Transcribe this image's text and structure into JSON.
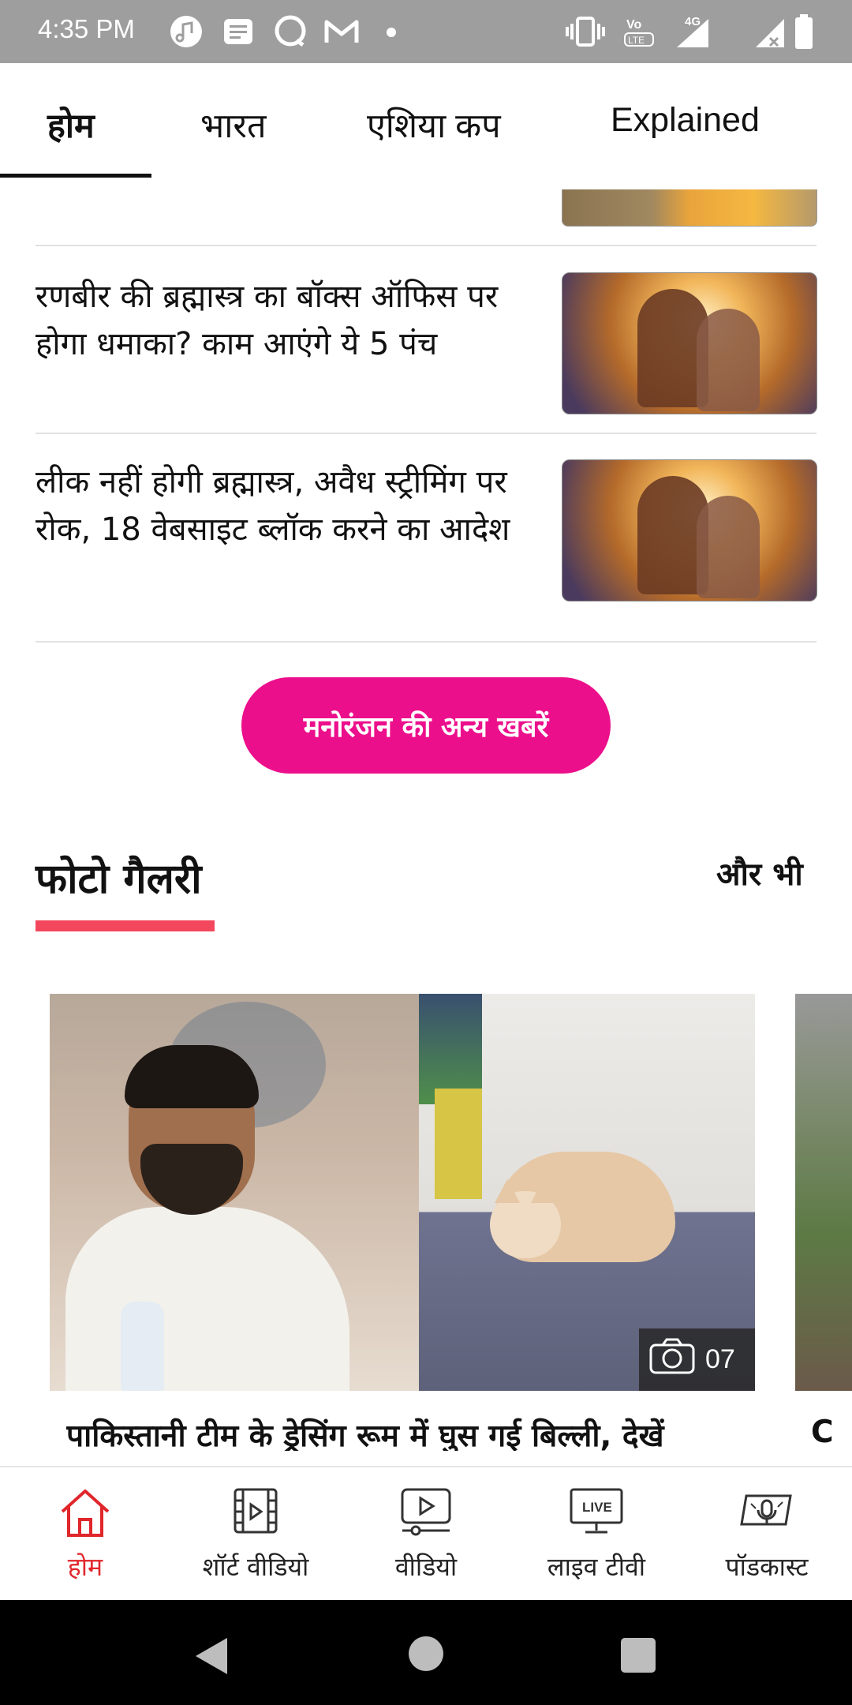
{
  "status_bar": {
    "time": "4:35 PM",
    "network": "4G"
  },
  "tabs": [
    {
      "label": "होम",
      "active": true
    },
    {
      "label": "भारत",
      "active": false
    },
    {
      "label": "एशिया कप",
      "active": false
    },
    {
      "label": "Explained",
      "active": false
    }
  ],
  "news": [
    {
      "title": "रणबीर की ब्रह्मास्त्र का बॉक्स ऑफिस पर होगा धमाका? काम आएंगे ये 5 पंच"
    },
    {
      "title": "लीक नहीं होगी ब्रह्मास्त्र, अवैध स्ट्रीमिंग पर रोक, 18 वेबसाइट ब्लॉक करने का आदेश"
    }
  ],
  "more_button": "मनोरंजन की अन्य खबरें",
  "gallery": {
    "section_title": "फोटो गैलरी",
    "more_link": "और भी",
    "card": {
      "photo_count": "07",
      "caption": "पाकिस्तानी टीम के ड्रेसिंग रूम में घुस गई बिल्ली, देखें"
    },
    "next_caption_start": "C"
  },
  "bottom_nav": [
    {
      "label": "होम",
      "icon": "home-icon",
      "active": true
    },
    {
      "label": "शॉर्ट वीडियो",
      "icon": "short-video-icon",
      "active": false
    },
    {
      "label": "वीडियो",
      "icon": "video-icon",
      "active": false
    },
    {
      "label": "लाइव टीवी",
      "icon": "live-tv-icon",
      "active": false,
      "badge": "LIVE"
    },
    {
      "label": "पॉडकास्ट",
      "icon": "podcast-icon",
      "active": false
    }
  ],
  "colors": {
    "accent_pink": "#ec0f8c",
    "section_underline": "#f2475c",
    "active_nav": "#e0262b"
  }
}
